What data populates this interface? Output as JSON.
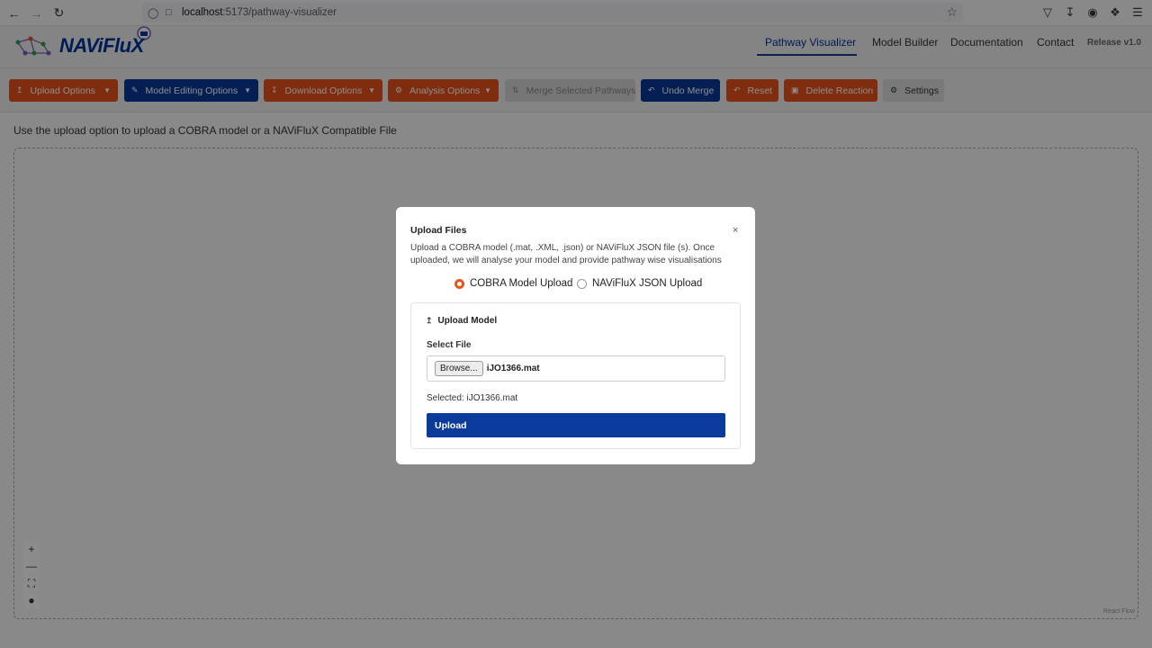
{
  "browser": {
    "url_host": "localhost",
    "url_path": ":5173/pathway-visualizer"
  },
  "header": {
    "logo_text": "NAViFluX",
    "nav": [
      "Pathway Visualizer",
      "Model Builder",
      "Documentation",
      "Contact"
    ],
    "active_nav": "Pathway Visualizer",
    "release": "Release v1.0"
  },
  "toolbar": {
    "upload_options": "Upload Options",
    "model_editing_options": "Model Editing Options",
    "download_options": "Download Options",
    "analysis_options": "Analysis Options",
    "merge_selected_pathways": "Merge Selected Pathways",
    "undo_merge": "Undo Merge",
    "reset": "Reset",
    "delete_reaction": "Delete Reaction",
    "settings": "Settings"
  },
  "main": {
    "instruction": "Use the upload option to upload a COBRA model or a NAViFluX Compatible File",
    "react_flow_label": "React Flow"
  },
  "modal": {
    "title": "Upload Files",
    "close": "×",
    "description": "Upload a COBRA model (.mat, .XML, .json) or NAViFluX JSON file (s). Once uploaded, we will analyse your model and provide pathway wise visualisations",
    "radio_cobra": "COBRA Model Upload",
    "radio_json": "NAViFluX JSON Upload",
    "selected_mode": "COBRA Model Upload",
    "card_title": "Upload Model",
    "select_file_label": "Select File",
    "browse_label": "Browse...",
    "file_name": "iJO1366.mat",
    "selected_text": "Selected: iJO1366.mat",
    "upload_button": "Upload"
  },
  "colors": {
    "orange": "#e8531a",
    "blue": "#0a3a9c"
  }
}
